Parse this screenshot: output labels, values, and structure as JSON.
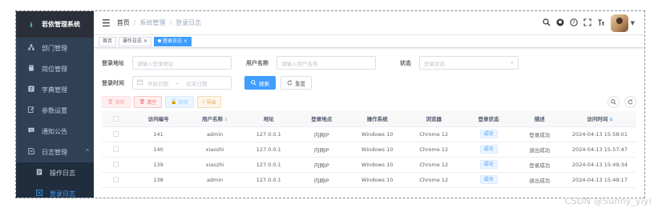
{
  "app": {
    "title": "若依管理系统"
  },
  "sidebar": {
    "items": [
      {
        "label": "部门管理",
        "icon": "tree-icon"
      },
      {
        "label": "岗位管理",
        "icon": "post-icon"
      },
      {
        "label": "字典管理",
        "icon": "dict-icon"
      },
      {
        "label": "参数设置",
        "icon": "edit-icon"
      },
      {
        "label": "通知公告",
        "icon": "message-icon"
      }
    ],
    "log_group": {
      "label": "日志管理",
      "icon": "log-icon"
    },
    "sub_items": [
      {
        "label": "操作日志",
        "icon": "form-icon",
        "active": false
      },
      {
        "label": "登录日志",
        "icon": "logininfor-icon",
        "active": true
      }
    ]
  },
  "navbar": {
    "breadcrumb": [
      "首页",
      "系统管理",
      "登录日志"
    ],
    "icons": [
      "search-icon",
      "github-icon",
      "question-icon",
      "fullscreen-icon",
      "font-size-icon",
      "avatar"
    ]
  },
  "tags": [
    {
      "label": "首页",
      "active": false,
      "closable": false
    },
    {
      "label": "操作日志",
      "active": false,
      "closable": true
    },
    {
      "label": "登录日志",
      "active": true,
      "closable": true
    }
  ],
  "search": {
    "ip_label": "登录地址",
    "ip_placeholder": "请输入登录地址",
    "user_label": "用户名称",
    "user_placeholder": "请输入用户名称",
    "status_label": "状态",
    "status_placeholder": "登录状态",
    "time_label": "登录时间",
    "start_placeholder": "开始日期",
    "range_sep": "-",
    "end_placeholder": "结束日期",
    "search_btn": "搜索",
    "reset_btn": "重置"
  },
  "toolbar": {
    "delete": "删除",
    "clean": "清空",
    "unlock": "解锁",
    "export": "导出"
  },
  "table": {
    "headers": [
      "访问编号",
      "用户名称",
      "地址",
      "登录地点",
      "操作系统",
      "浏览器",
      "登录状态",
      "描述",
      "访问时间"
    ],
    "rows": [
      {
        "id": "141",
        "user": "admin",
        "ip": "127.0.0.1",
        "location": "内网IP",
        "os": "Windows 10",
        "browser": "Chrome 12",
        "status": "成功",
        "msg": "登录成功",
        "time": "2024-04-13 15:58:01"
      },
      {
        "id": "140",
        "user": "xiaozhi",
        "ip": "127.0.0.1",
        "location": "内网IP",
        "os": "Windows 10",
        "browser": "Chrome 12",
        "status": "成功",
        "msg": "退出成功",
        "time": "2024-04-13 15:57:47"
      },
      {
        "id": "139",
        "user": "xiaozhi",
        "ip": "127.0.0.1",
        "location": "内网IP",
        "os": "Windows 10",
        "browser": "Chrome 12",
        "status": "成功",
        "msg": "登录成功",
        "time": "2024-04-13 15:49:34"
      },
      {
        "id": "138",
        "user": "admin",
        "ip": "127.0.0.1",
        "location": "内网IP",
        "os": "Windows 10",
        "browser": "Chrome 12",
        "status": "成功",
        "msg": "退出成功",
        "time": "2024-04-13 15:49:17"
      }
    ]
  },
  "watermark": "CSDN @Sunny_yiyi",
  "colors": {
    "sidebar_bg": "#304156",
    "primary": "#409eff",
    "danger": "#f56c6c",
    "warning": "#e6a23c"
  }
}
